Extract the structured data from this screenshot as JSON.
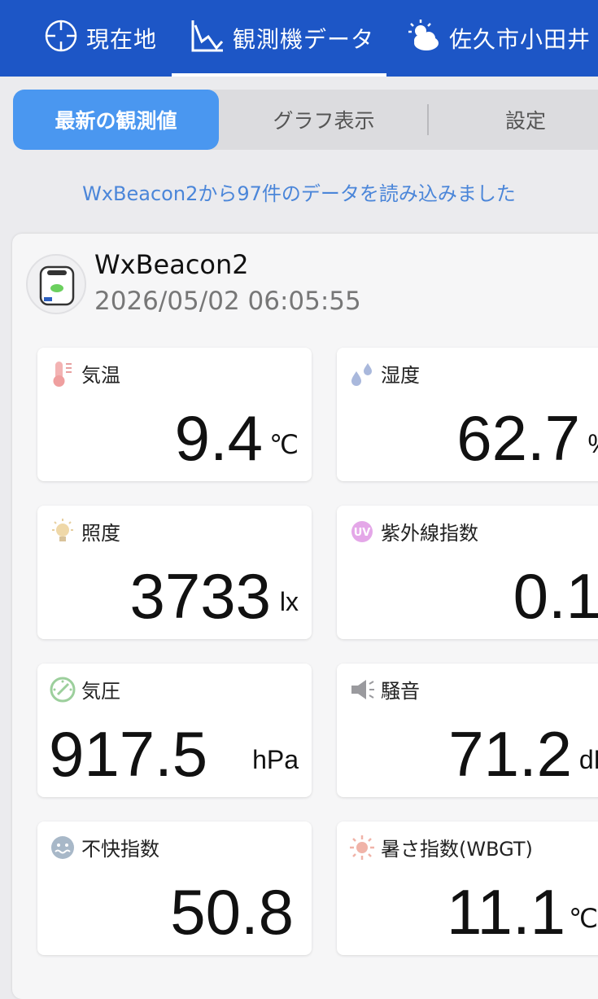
{
  "topnav": {
    "items": [
      {
        "label": "現在地",
        "icon": "crosshair-icon"
      },
      {
        "label": "観測機データ",
        "icon": "line-chart-icon"
      },
      {
        "label": "佐久市小田井",
        "icon": "partly-cloudy-icon"
      }
    ],
    "active_index": 1
  },
  "tabs": {
    "items": [
      "最新の観測値",
      "グラフ表示",
      "設定"
    ],
    "active_index": 0
  },
  "status_message": "WxBeacon2から97件のデータを読み込みました",
  "device": {
    "name": "WxBeacon2",
    "timestamp": "2026/05/02 06:05:55",
    "icon": "beacon-device-icon"
  },
  "measurements": {
    "temperature": {
      "label": "気温",
      "value": "9.4",
      "unit": "℃",
      "icon": "thermometer-icon"
    },
    "humidity": {
      "label": "湿度",
      "value": "62.7",
      "unit": "%",
      "icon": "water-drops-icon"
    },
    "illuminance": {
      "label": "照度",
      "value": "3733",
      "unit": "lx",
      "icon": "light-bulb-icon"
    },
    "uv_index": {
      "label": "紫外線指数",
      "value": "0.1",
      "unit": "",
      "icon": "uv-icon"
    },
    "pressure": {
      "label": "気圧",
      "value": "917.5",
      "unit": "hPa",
      "icon": "gauge-icon"
    },
    "noise": {
      "label": "騒音",
      "value": "71.2",
      "unit": "dB",
      "icon": "megaphone-icon"
    },
    "discomfort_index": {
      "label": "不快指数",
      "value": "50.8",
      "unit": "",
      "icon": "sweat-face-icon"
    },
    "wbgt": {
      "label": "暑さ指数(WBGT)",
      "value": "11.1",
      "unit": "℃",
      "icon": "sun-icon"
    }
  },
  "colors": {
    "nav_bg": "#1d56c6",
    "tab_active": "#4a97f0",
    "status_text": "#4b86d9"
  }
}
